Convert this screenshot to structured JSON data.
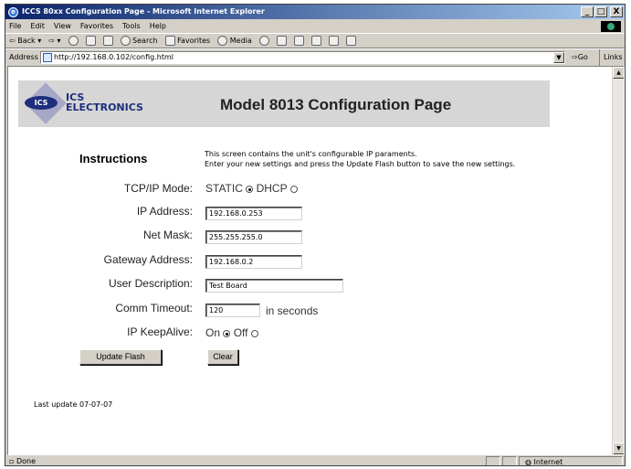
{
  "window": {
    "title": "ICCS 80xx Configuration Page - Microsoft Internet Explorer",
    "controls": [
      "_",
      "□",
      "X"
    ]
  },
  "menu": [
    "File",
    "Edit",
    "View",
    "Favorites",
    "Tools",
    "Help"
  ],
  "toolbar": {
    "back": "Back",
    "search": "Search",
    "favorites": "Favorites",
    "media": "Media"
  },
  "address": {
    "label": "Address",
    "url": "http://192.168.0.102/config.html",
    "go": "Go",
    "links": "Links"
  },
  "banner": {
    "logo_mark": "ICS",
    "logo_line1": "ICS",
    "logo_line2": "ELECTRONICS",
    "title": "Model 8013 Configuration Page"
  },
  "instructions": {
    "heading": "Instructions",
    "line1": "This screen contains the unit's configurable IP paraments.",
    "line2": "Enter your new settings and press the Update Flash button to save the new settings."
  },
  "form": {
    "tcpip_mode": {
      "label": "TCP/IP Mode:",
      "option1": "STATIC",
      "option2": "DHCP",
      "selected": "STATIC"
    },
    "ip_address": {
      "label": "IP Address:",
      "value": "192.168.0.253"
    },
    "net_mask": {
      "label": "Net Mask:",
      "value": "255.255.255.0"
    },
    "gateway": {
      "label": "Gateway Address:",
      "value": "192.168.0.2"
    },
    "description": {
      "label": "User Description:",
      "value": "Test Board"
    },
    "timeout": {
      "label": "Comm Timeout:",
      "value": "120",
      "unit": "in seconds"
    },
    "keepalive": {
      "label": "IP KeepAlive:",
      "option1": "On",
      "option2": "Off",
      "selected": "On"
    },
    "update_button": "Update Flash",
    "clear_button": "Clear"
  },
  "footer": {
    "last_update": "Last update 07-07-07"
  },
  "status": {
    "text": "Done",
    "zone": "Internet"
  }
}
